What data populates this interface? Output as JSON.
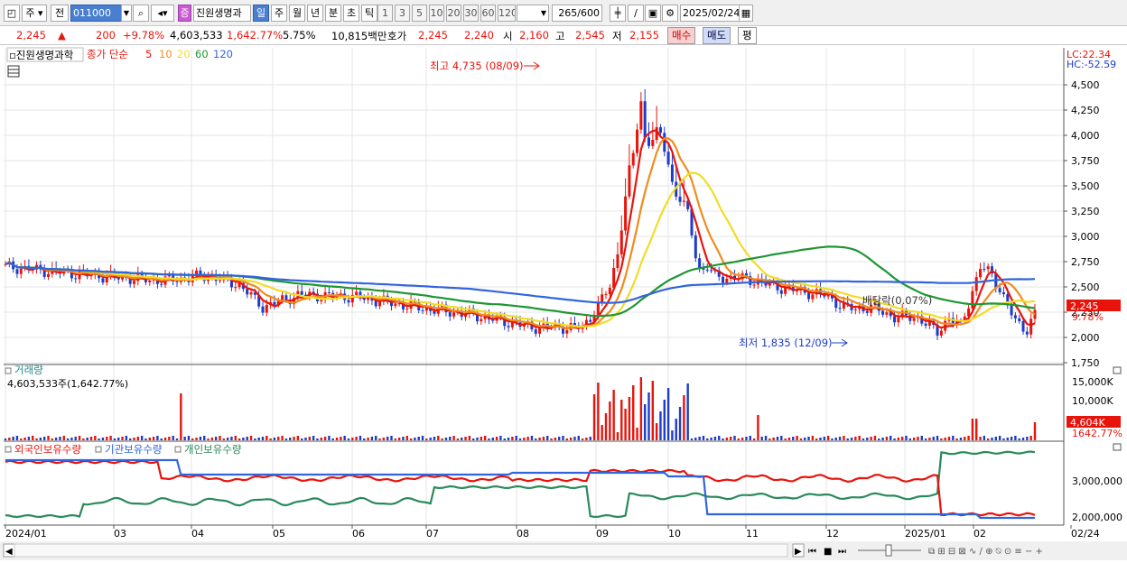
{
  "toolbar": {
    "market": "주",
    "period_select": "전",
    "code": "011000",
    "name": "진원생명과",
    "badge": "증",
    "tf": [
      "일",
      "주",
      "월",
      "년",
      "분",
      "초",
      "틱"
    ],
    "nums": [
      "1",
      "3",
      "5",
      "10",
      "20",
      "30",
      "60",
      "120"
    ],
    "count": "265",
    "total": "/600",
    "date": "2025/02/24"
  },
  "quote": {
    "price": "2,245",
    "arrow": "▲",
    "change": "200",
    "pct": "+9.78%",
    "volume": "4,603,533",
    "vol_pct": "1,642.77%",
    "turnover": "5.75%",
    "amount": "10,815백만",
    "ask_label": "호가",
    "ask": "2,245",
    "bid": "2,240",
    "open_label": "시",
    "open": "2,160",
    "high_label": "고",
    "high": "2,545",
    "low_label": "저",
    "low": "2,155",
    "buy": "매수",
    "sell": "매도",
    "avg": "평"
  },
  "price_panel": {
    "stock_title": "진원생명과학",
    "legend_type": "종가 단순",
    "ma": [
      {
        "label": "5",
        "color": "#e8140c"
      },
      {
        "label": "10",
        "color": "#f08c1e"
      },
      {
        "label": "20",
        "color": "#f0dc28"
      },
      {
        "label": "60",
        "color": "#1e9632"
      },
      {
        "label": "120",
        "color": "#3264dc"
      }
    ],
    "lc": "LC:22.34",
    "hc": "HC:-52.59",
    "high_note": "최고 4,735 (08/09)",
    "low_note": "최저 1,835 (12/09)",
    "dividend_note": "배당락(0.07%)",
    "current_price": "2,245",
    "current_pct": "9.78%",
    "y_ticks": [
      "4,500",
      "4,250",
      "4,000",
      "3,750",
      "3,500",
      "3,250",
      "3,000",
      "2,750",
      "2,500",
      "2,250",
      "2,000",
      "1,750"
    ],
    "y_values": [
      4500,
      4250,
      4000,
      3750,
      3500,
      3250,
      3000,
      2750,
      2500,
      2250,
      2000,
      1750
    ]
  },
  "volume_panel": {
    "title": "거래량",
    "value": "4,603,533주(1,642.77%)",
    "y_ticks": [
      "15,000K",
      "10,000K"
    ],
    "current": "4,604K",
    "current_pct": "1642.77%"
  },
  "holding_panel": {
    "series": [
      {
        "label": "외국인보유수량",
        "color": "#e8140c"
      },
      {
        "label": "기관보유수량",
        "color": "#3264dc"
      },
      {
        "label": "개인보유수량",
        "color": "#2a8a5a"
      }
    ],
    "y_ticks": [
      "3,000,000",
      "2,000,000"
    ]
  },
  "x_axis": [
    "2024/01",
    "03",
    "04",
    "05",
    "06",
    "07",
    "08",
    "09",
    "10",
    "11",
    "12",
    "2025/01",
    "02",
    "02/24"
  ],
  "colors": {
    "up": "#e8140c",
    "down": "#1e3cc8",
    "accent": "#4a7fd0"
  }
}
